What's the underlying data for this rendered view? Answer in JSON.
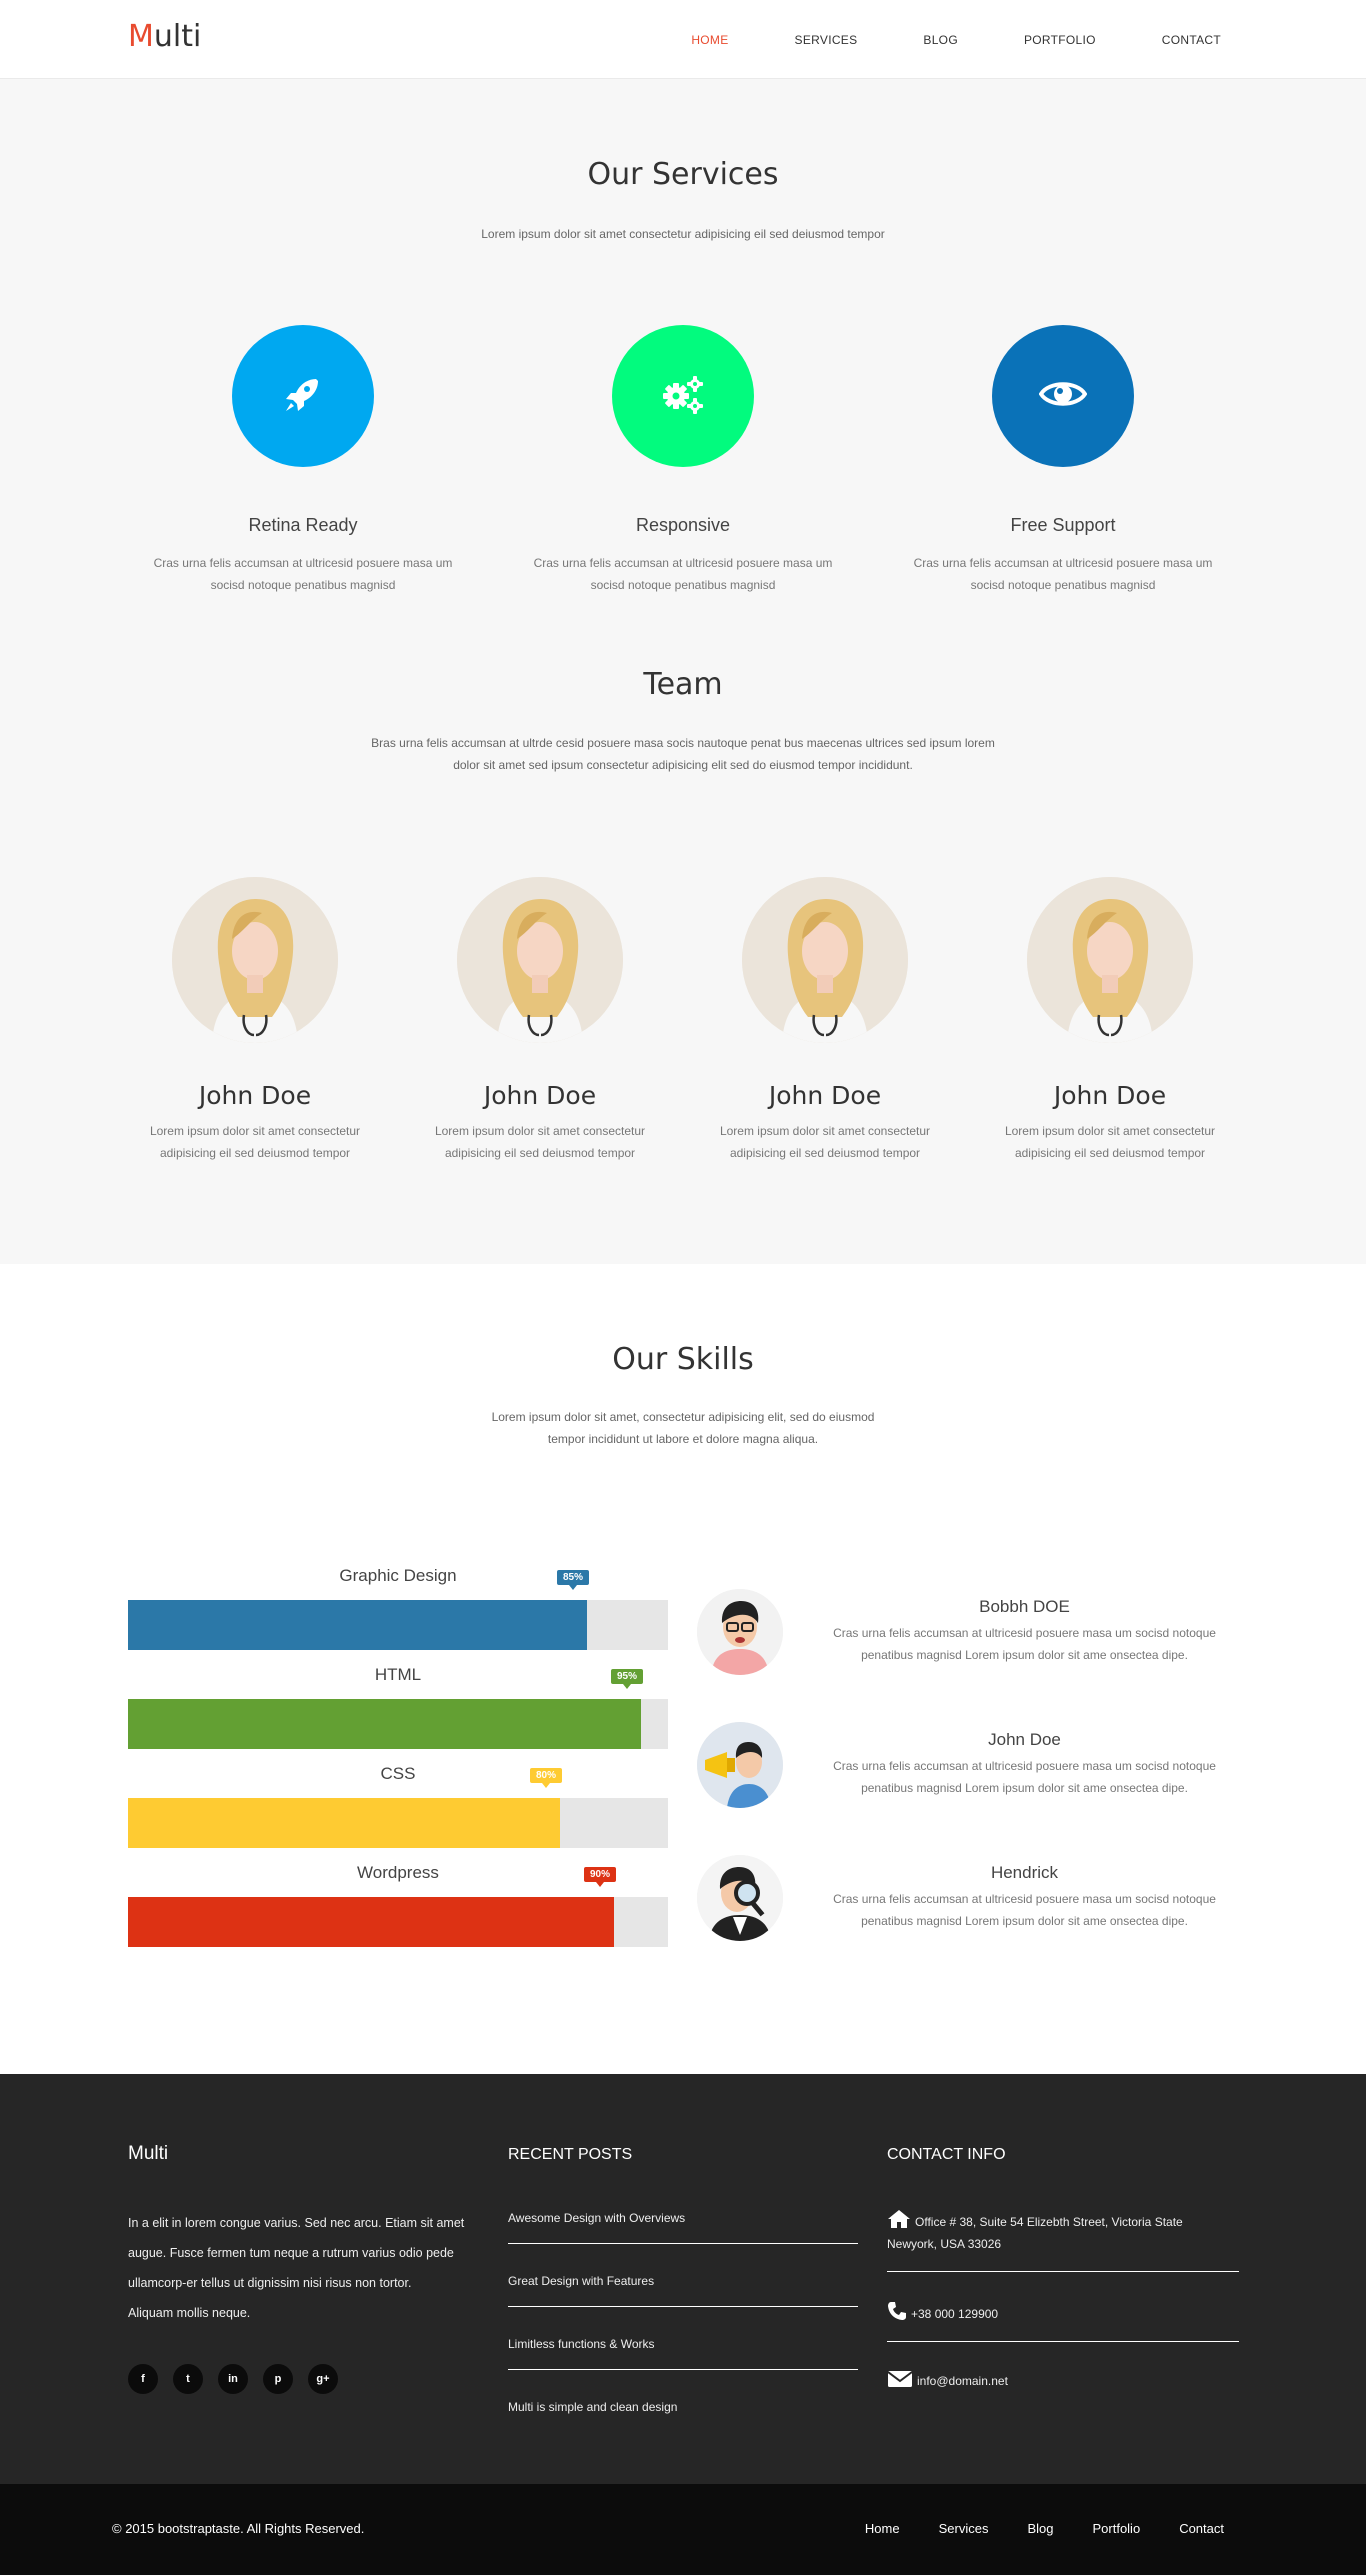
{
  "header": {
    "logo_first": "M",
    "logo_rest": "ulti",
    "nav": [
      "HOME",
      "SERVICES",
      "BLOG",
      "PORTFOLIO",
      "CONTACT"
    ],
    "active_nav": "HOME"
  },
  "services": {
    "title": "Our Services",
    "subtitle": "Lorem ipsum dolor sit amet consectetur adipisicing eil sed deiusmod tempor",
    "items": [
      {
        "icon": "rocket-icon",
        "color": "#00a8f0",
        "name": "Retina Ready",
        "desc": "Cras urna felis accumsan at ultricesid posuere masa um socisd notoque penatibus magnisd"
      },
      {
        "icon": "gears-icon",
        "color": "#02fb7e",
        "name": "Responsive",
        "desc": "Cras urna felis accumsan at ultricesid posuere masa um socisd notoque penatibus magnisd"
      },
      {
        "icon": "eye-icon",
        "color": "#0a72b8",
        "name": "Free Support",
        "desc": "Cras urna felis accumsan at ultricesid posuere masa um socisd notoque penatibus magnisd"
      }
    ]
  },
  "team": {
    "title": "Team",
    "subtitle_line1": "Bras urna felis accumsan at ultrde cesid posuere masa socis nautoque penat bus maecenas ultrices sed ipsum lorem",
    "subtitle_line2": "dolor sit amet sed ipsum consectetur adipisicing elit sed do eiusmod tempor incididunt.",
    "members": [
      {
        "name": "John Doe",
        "desc_line1": "Lorem ipsum dolor sit amet consectetur",
        "desc_line2": "adipisicing eil sed deiusmod tempor"
      },
      {
        "name": "John Doe",
        "desc_line1": "Lorem ipsum dolor sit amet consectetur",
        "desc_line2": "adipisicing eil sed deiusmod tempor"
      },
      {
        "name": "John Doe",
        "desc_line1": "Lorem ipsum dolor sit amet consectetur",
        "desc_line2": "adipisicing eil sed deiusmod tempor"
      },
      {
        "name": "John Doe",
        "desc_line1": "Lorem ipsum dolor sit amet consectetur",
        "desc_line2": "adipisicing eil sed deiusmod tempor"
      }
    ]
  },
  "skills": {
    "title": "Our Skills",
    "subtitle_line1": "Lorem ipsum dolor sit amet, consectetur adipisicing elit, sed do eiusmod",
    "subtitle_line2": "tempor incididunt ut labore et dolore magna aliqua.",
    "bars": [
      {
        "label": "Graphic Design",
        "percent": 85,
        "badge": "85%",
        "color": "#2b78a8"
      },
      {
        "label": "HTML",
        "percent": 95,
        "badge": "95%",
        "color": "#63a033"
      },
      {
        "label": "CSS",
        "percent": 80,
        "badge": "80%",
        "color": "#fecb32"
      },
      {
        "label": "Wordpress",
        "percent": 90,
        "badge": "90%",
        "color": "#dd3214"
      }
    ],
    "testimonials": [
      {
        "name": "Bobbh DOE",
        "desc_line1": "Cras urna felis accumsan at ultricesid posuere masa um socisd notoque",
        "desc_line2": "penatibus magnisd Lorem ipsum dolor sit ame onsectea dipe."
      },
      {
        "name": "John Doe",
        "desc_line1": "Cras urna felis accumsan at ultricesid posuere masa um socisd notoque",
        "desc_line2": "penatibus magnisd Lorem ipsum dolor sit ame onsectea dipe."
      },
      {
        "name": "Hendrick",
        "desc_line1": "Cras urna felis accumsan at ultricesid posuere masa um socisd notoque",
        "desc_line2": "penatibus magnisd Lorem ipsum dolor sit ame onsectea dipe."
      }
    ]
  },
  "footer": {
    "brand": "Multi",
    "about_lines": [
      "In a elit in lorem congue varius. Sed nec arcu. Etiam sit amet",
      "augue. Fusce fermen tum neque a rutrum varius odio pede",
      "ullamcorp-er tellus ut dignissim nisi risus non tortor.",
      "Aliquam mollis neque."
    ],
    "social": [
      "f",
      "t",
      "in",
      "p",
      "g+"
    ],
    "social_icons": [
      "facebook-icon",
      "twitter-icon",
      "linkedin-icon",
      "pinterest-icon",
      "google-plus-icon"
    ],
    "recent_title": "RECENT POSTS",
    "posts": [
      "Awesome Design with Overviews",
      "Great Design with Features",
      "Limitless functions & Works",
      "Multi is simple and clean design"
    ],
    "contact_title": "CONTACT INFO",
    "address_line1": "Office # 38, Suite 54 Elizebth Street, Victoria State",
    "address_line2": "Newyork, USA 33026",
    "phone": "+38 000 129900",
    "email": "info@domain.net"
  },
  "bottom": {
    "copyright": "© 2015 bootstraptaste. All Rights Reserved.",
    "nav": [
      "Home",
      "Services",
      "Blog",
      "Portfolio",
      "Contact"
    ]
  }
}
